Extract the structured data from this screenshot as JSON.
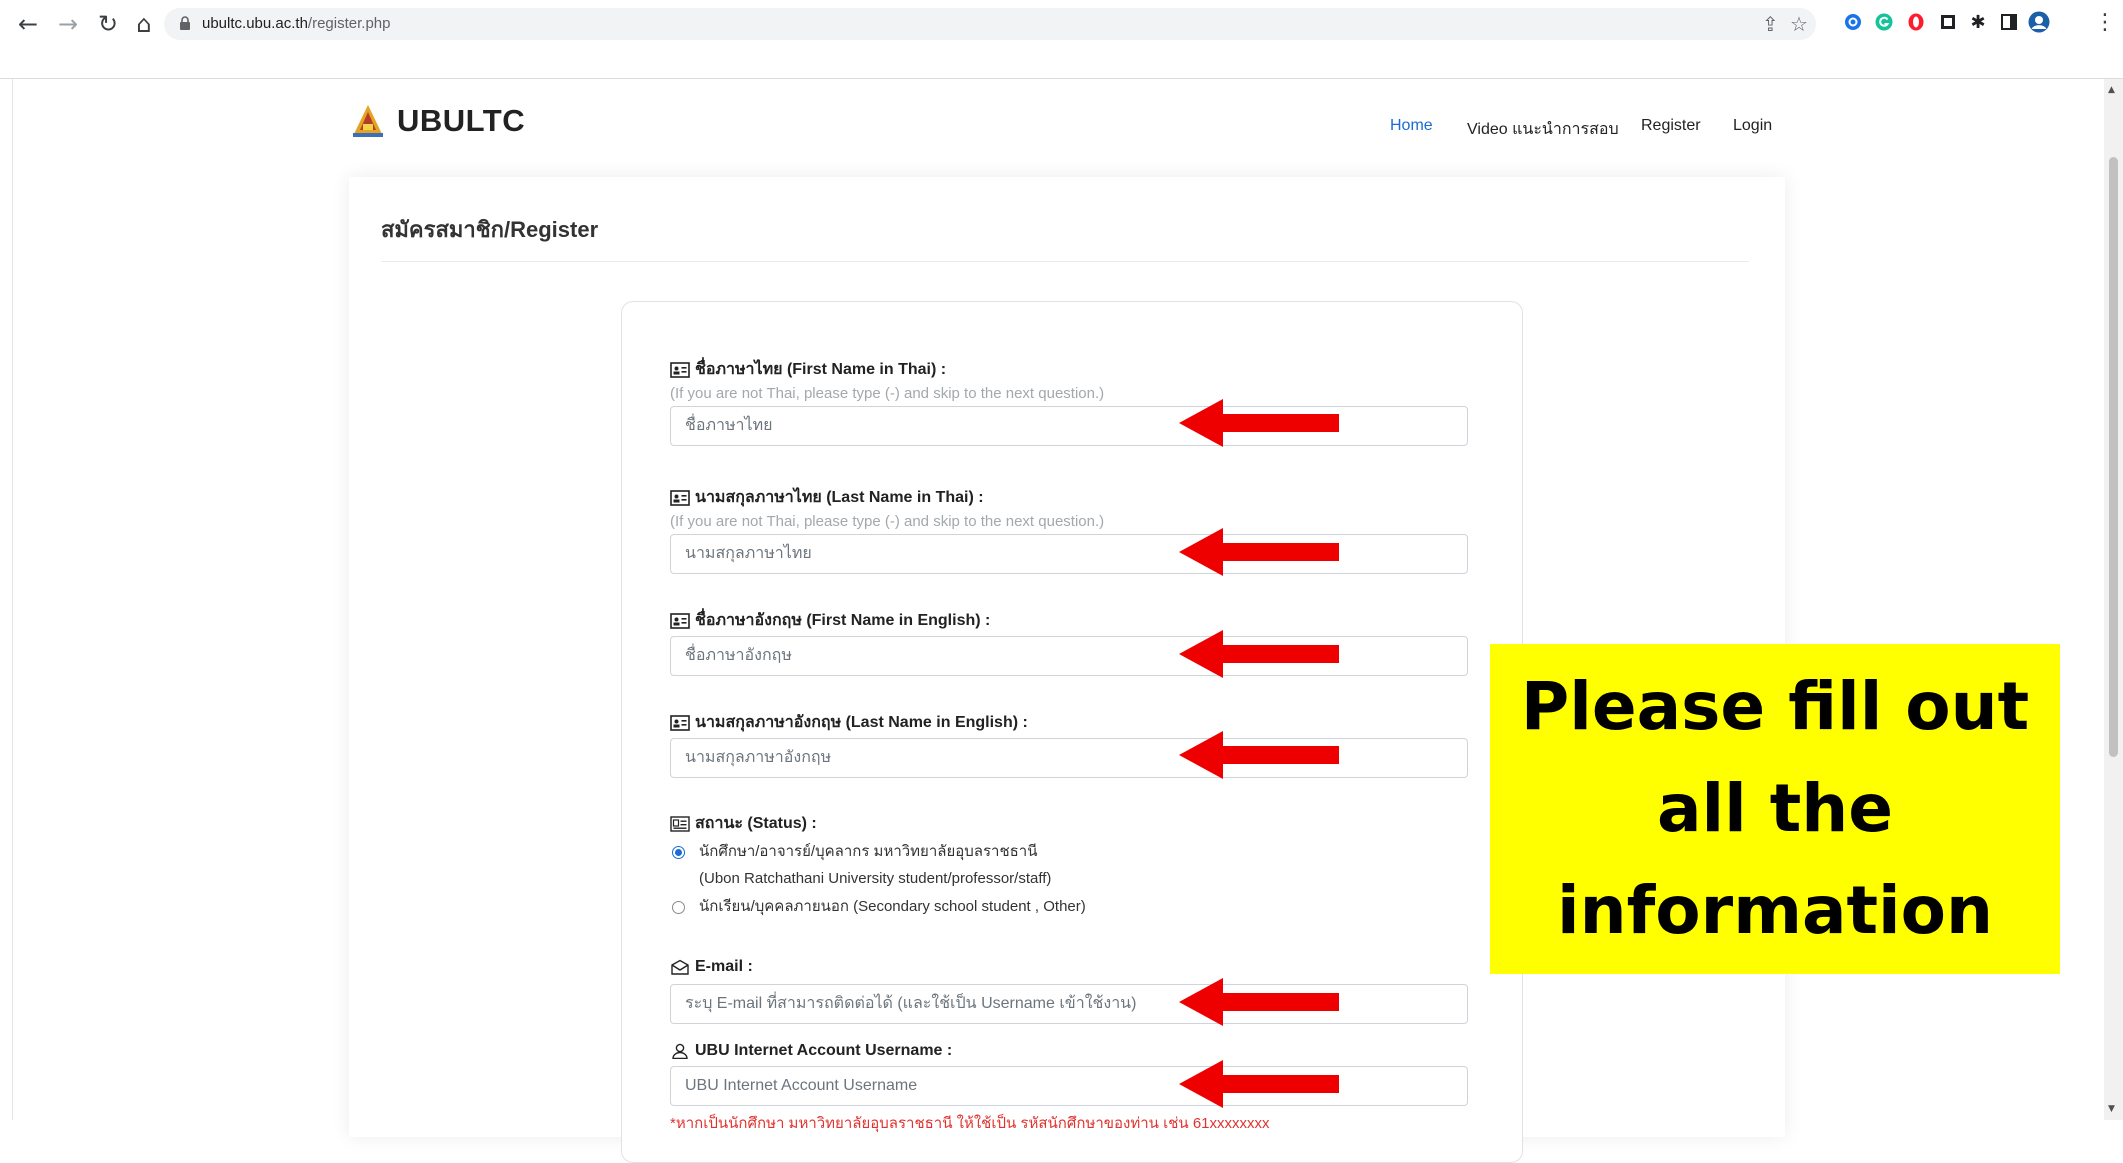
{
  "browser": {
    "url_host": "ubultc.ubu.ac.th",
    "url_path": "/register.php",
    "icons": {
      "back": "arrow-left-icon",
      "forward": "arrow-right-icon",
      "reload": "reload-icon",
      "home": "home-icon",
      "lock": "lock-icon",
      "share": "share-icon",
      "bookmark": "star-icon",
      "menu": "kebab-menu-icon"
    }
  },
  "site": {
    "brand": "UBULTC",
    "nav": [
      "Home",
      "Video แนะนำการสอบ",
      "Register",
      "Login"
    ],
    "active_nav": "Home"
  },
  "register": {
    "title": "สมัครสมาชิก/Register",
    "first_name_th": {
      "label": "ชื่อภาษาไทย (First Name in Thai) :",
      "hint": "(If you are not Thai, please type (-) and skip to the next question.)",
      "placeholder": "ชื่อภาษาไทย"
    },
    "last_name_th": {
      "label": "นามสกุลภาษาไทย (Last Name in Thai) :",
      "hint": "(If you are not Thai, please type (-) and skip to the next question.)",
      "placeholder": "นามสกุลภาษาไทย"
    },
    "first_name_en": {
      "label": "ชื่อภาษาอังกฤษ (First Name in English) :",
      "placeholder": "ชื่อภาษาอังกฤษ"
    },
    "last_name_en": {
      "label": "นามสกุลภาษาอังกฤษ (Last Name in English) :",
      "placeholder": "นามสกุลภาษาอังกฤษ"
    },
    "status": {
      "label": "สถานะ (Status) :",
      "options": [
        {
          "line1": "นักศึกษา/อาจารย์/บุคลากร มหาวิทยาลัยอุบลราชธานี",
          "line2": "(Ubon Ratchathani University student/professor/staff)",
          "checked": true
        },
        {
          "line1": "นักเรียน/บุคคลภายนอก (Secondary school student , Other)",
          "line2": "",
          "checked": false
        }
      ]
    },
    "email": {
      "label": "E-mail :",
      "placeholder": "ระบุ E-mail ที่สามารถติดต่อได้ (และใช้เป็น Username เข้าใช้งาน)"
    },
    "ubu_username": {
      "label": "UBU Internet Account Username :",
      "placeholder": "UBU Internet Account Username",
      "warning": "*หากเป็นนักศึกษา มหาวิทยาลัยอุบลราชธานี ให้ใช้เป็น รหัสนักศึกษาของท่าน เช่น 61xxxxxxxx"
    }
  },
  "annotation": {
    "callout": "Please fill out all the information",
    "callout_bg": "#ffff00",
    "arrow_color": "#ee0000"
  },
  "colors": {
    "accent": "#1b6cd3",
    "warning": "#e0332f"
  }
}
